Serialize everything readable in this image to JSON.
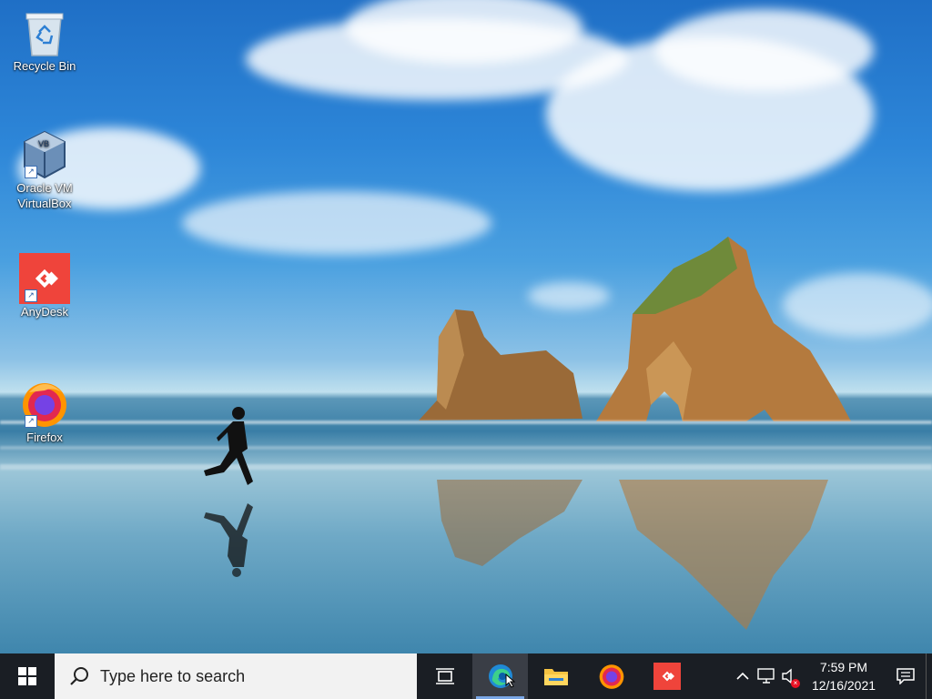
{
  "desktop": {
    "icons": [
      {
        "label": "Recycle Bin",
        "icon": "recycle-bin-icon",
        "shortcut": false
      },
      {
        "label": "Oracle VM VirtualBox",
        "icon": "virtualbox-icon",
        "shortcut": true
      },
      {
        "label": "AnyDesk",
        "icon": "anydesk-icon",
        "shortcut": true
      },
      {
        "label": "Firefox",
        "icon": "firefox-icon",
        "shortcut": true
      }
    ]
  },
  "taskbar": {
    "search_placeholder": "Type here to search",
    "pinned": [
      {
        "name": "task-view",
        "icon": "task-view-icon",
        "active": false
      },
      {
        "name": "edge",
        "icon": "edge-icon",
        "active": true
      },
      {
        "name": "file-explorer",
        "icon": "folder-icon",
        "active": false
      },
      {
        "name": "firefox",
        "icon": "firefox-icon",
        "active": false
      },
      {
        "name": "anydesk",
        "icon": "anydesk-icon",
        "active": false
      }
    ],
    "clock": {
      "time": "7:59 PM",
      "date": "12/16/2021"
    }
  },
  "colors": {
    "taskbar": "#1a1e24",
    "anydesk": "#ef443b",
    "accent": "#7aa7e6"
  }
}
